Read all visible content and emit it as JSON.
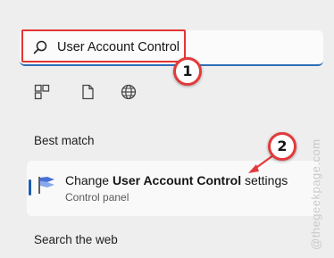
{
  "search": {
    "query": "User Account Control",
    "icon": "search-icon"
  },
  "filters": [
    {
      "name": "apps",
      "icon": "apps-icon"
    },
    {
      "name": "documents",
      "icon": "document-icon"
    },
    {
      "name": "web",
      "icon": "globe-icon"
    }
  ],
  "sections": {
    "best_match": "Best match",
    "search_web": "Search the web"
  },
  "best_match_result": {
    "title_prefix": "Change ",
    "title_bold": "User Account Control",
    "title_suffix": " settings",
    "subtitle": "Control panel",
    "icon": "uac-flag-icon"
  },
  "annotations": {
    "badge_1": "1",
    "badge_2": "2"
  },
  "watermark": "@thegeekpage.com",
  "colors": {
    "accent": "#2f6fb7",
    "annotation_red": "#e23a3a"
  }
}
